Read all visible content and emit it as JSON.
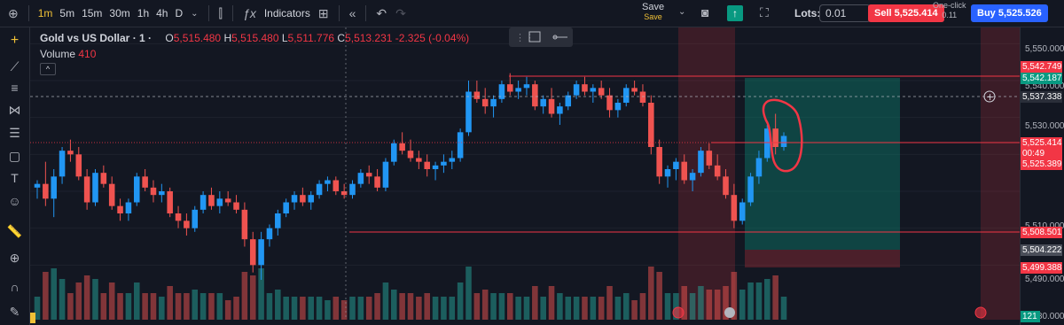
{
  "toolbar": {
    "intervals": [
      "1m",
      "5m",
      "15m",
      "30m",
      "1h",
      "4h",
      "D"
    ],
    "active_interval": "1m",
    "indicators_label": "Indicators",
    "save_label": "Save",
    "save_sub": "Save",
    "lots_label": "Lots:",
    "lots_value": "0.01",
    "sell_label": "Sell 5,525.414",
    "buy_label": "Buy 5,525.526",
    "one_click_label": "One-click",
    "spread": "0.11"
  },
  "legend": {
    "symbol": "Gold vs US Dollar · 1 ·",
    "open_label": "O",
    "open": "5,515.480",
    "high_label": "H",
    "high": "5,515.480",
    "low_label": "L",
    "low": "5,511.776",
    "close_label": "C",
    "close": "5,513.231",
    "change": "-2.325 (-0.04%)",
    "volume_label": "Volume",
    "volume": "410"
  },
  "price_axis": {
    "ticks": [
      "5,550.000",
      "5,540.000",
      "5,530.000",
      "5,510.000",
      "5,490.000",
      "5,480.000"
    ],
    "tags": [
      {
        "text": "5,542.749",
        "color": "#f23645"
      },
      {
        "text": "5,542.187",
        "color": "#089981"
      },
      {
        "text": "5,537.338",
        "color": "#2a2e39"
      },
      {
        "text": "5,525.414",
        "color": "#f23645"
      },
      {
        "text": "00:49",
        "color": "#f23645"
      },
      {
        "text": "5,525.389",
        "color": "#f23645"
      },
      {
        "text": "5,508.501",
        "color": "#f23645"
      },
      {
        "text": "5,504.222",
        "color": "#4a4e59"
      },
      {
        "text": "5,499.388",
        "color": "#f23645"
      },
      {
        "text": "121",
        "color": "#089981"
      }
    ]
  },
  "chart_data": {
    "type": "candlestick",
    "instrument": "Gold vs US Dollar",
    "timeframe": "1m",
    "ylim": [
      5480,
      5552
    ],
    "colors": {
      "up": "#2196f3",
      "down": "#ef5350"
    },
    "candles": [
      [
        5511,
        5513,
        5508,
        5512
      ],
      [
        5512,
        5518,
        5506,
        5508
      ],
      [
        5508,
        5516,
        5503,
        5514
      ],
      [
        5514,
        5522,
        5512,
        5521
      ],
      [
        5521,
        5524,
        5518,
        5520
      ],
      [
        5520,
        5522,
        5513,
        5514
      ],
      [
        5514,
        5516,
        5505,
        5507
      ],
      [
        5507,
        5516,
        5506,
        5515
      ],
      [
        5515,
        5517,
        5511,
        5512
      ],
      [
        5512,
        5514,
        5505,
        5506
      ],
      [
        5506,
        5508,
        5502,
        5504
      ],
      [
        5504,
        5508,
        5502,
        5507
      ],
      [
        5507,
        5515,
        5506,
        5514
      ],
      [
        5514,
        5516,
        5510,
        5511
      ],
      [
        5511,
        5513,
        5507,
        5509
      ],
      [
        5509,
        5512,
        5507,
        5510
      ],
      [
        5510,
        5511,
        5503,
        5504
      ],
      [
        5504,
        5506,
        5500,
        5502
      ],
      [
        5502,
        5504,
        5498,
        5500
      ],
      [
        5500,
        5506,
        5499,
        5505
      ],
      [
        5505,
        5510,
        5504,
        5509
      ],
      [
        5509,
        5511,
        5505,
        5506
      ],
      [
        5506,
        5510,
        5504,
        5508
      ],
      [
        5508,
        5510,
        5506,
        5507
      ],
      [
        5507,
        5509,
        5504,
        5505
      ],
      [
        5505,
        5507,
        5495,
        5497
      ],
      [
        5497,
        5499,
        5488,
        5490
      ],
      [
        5490,
        5499,
        5486,
        5497
      ],
      [
        5497,
        5501,
        5495,
        5500
      ],
      [
        5500,
        5505,
        5498,
        5504
      ],
      [
        5504,
        5508,
        5503,
        5507
      ],
      [
        5507,
        5510,
        5505,
        5509
      ],
      [
        5509,
        5511,
        5506,
        5507
      ],
      [
        5507,
        5510,
        5505,
        5509
      ],
      [
        5509,
        5513,
        5508,
        5512
      ],
      [
        5512,
        5514,
        5510,
        5513
      ],
      [
        5513,
        5514,
        5509,
        5510
      ],
      [
        5510,
        5512,
        5508,
        5509
      ],
      [
        5509,
        5513,
        5508,
        5512
      ],
      [
        5512,
        5516,
        5511,
        5515
      ],
      [
        5515,
        5517,
        5512,
        5514
      ],
      [
        5514,
        5516,
        5510,
        5511
      ],
      [
        5511,
        5519,
        5510,
        5518
      ],
      [
        5518,
        5524,
        5517,
        5523
      ],
      [
        5523,
        5526,
        5520,
        5521
      ],
      [
        5521,
        5524,
        5518,
        5519
      ],
      [
        5519,
        5521,
        5516,
        5518
      ],
      [
        5518,
        5520,
        5514,
        5516
      ],
      [
        5516,
        5518,
        5513,
        5517
      ],
      [
        5517,
        5520,
        5515,
        5518
      ],
      [
        5518,
        5521,
        5516,
        5519
      ],
      [
        5519,
        5527,
        5518,
        5526
      ],
      [
        5526,
        5540,
        5525,
        5537
      ],
      [
        5537,
        5540,
        5534,
        5535
      ],
      [
        5535,
        5538,
        5531,
        5533
      ],
      [
        5533,
        5536,
        5530,
        5535
      ],
      [
        5535,
        5540,
        5534,
        5539
      ],
      [
        5539,
        5542,
        5536,
        5537
      ],
      [
        5537,
        5540,
        5535,
        5538
      ],
      [
        5538,
        5541,
        5536,
        5539
      ],
      [
        5539,
        5540,
        5532,
        5533
      ],
      [
        5533,
        5536,
        5531,
        5535
      ],
      [
        5535,
        5538,
        5530,
        5531
      ],
      [
        5531,
        5534,
        5528,
        5533
      ],
      [
        5533,
        5537,
        5532,
        5536
      ],
      [
        5536,
        5540,
        5535,
        5539
      ],
      [
        5539,
        5541,
        5536,
        5537
      ],
      [
        5537,
        5539,
        5534,
        5538
      ],
      [
        5538,
        5540,
        5535,
        5536
      ],
      [
        5536,
        5538,
        5530,
        5532
      ],
      [
        5532,
        5535,
        5530,
        5534
      ],
      [
        5534,
        5539,
        5533,
        5538
      ],
      [
        5538,
        5540,
        5536,
        5537
      ],
      [
        5537,
        5539,
        5533,
        5534
      ],
      [
        5534,
        5536,
        5520,
        5522
      ],
      [
        5522,
        5524,
        5512,
        5514
      ],
      [
        5514,
        5517,
        5511,
        5516
      ],
      [
        5516,
        5519,
        5513,
        5518
      ],
      [
        5518,
        5520,
        5512,
        5513
      ],
      [
        5513,
        5516,
        5510,
        5515
      ],
      [
        5515,
        5522,
        5514,
        5521
      ],
      [
        5521,
        5523,
        5516,
        5517
      ],
      [
        5517,
        5520,
        5513,
        5514
      ],
      [
        5514,
        5516,
        5508,
        5509
      ],
      [
        5509,
        5512,
        5500,
        5502
      ],
      [
        5502,
        5508,
        5501,
        5507
      ],
      [
        5507,
        5515,
        5506,
        5514
      ],
      [
        5514,
        5521,
        5512,
        5519
      ],
      [
        5519,
        5528,
        5518,
        5527
      ],
      [
        5527,
        5531,
        5520,
        5522
      ],
      [
        5522,
        5526,
        5521,
        5525
      ]
    ]
  }
}
